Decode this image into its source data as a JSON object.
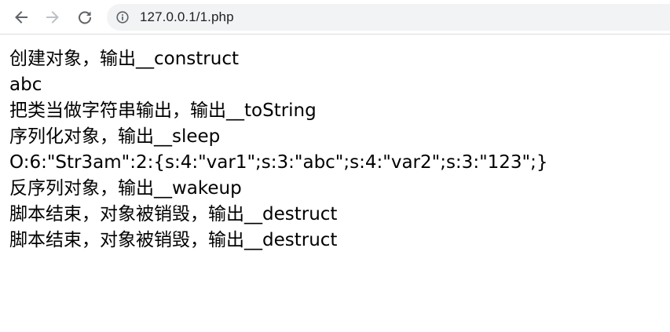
{
  "browser": {
    "url": "127.0.0.1/1.php"
  },
  "output_lines": [
    "创建对象，输出__construct",
    "abc",
    "把类当做字符串输出，输出__toString",
    "序列化对象，输出__sleep",
    "O:6:\"Str3am\":2:{s:4:\"var1\";s:3:\"abc\";s:4:\"var2\";s:3:\"123\";}",
    "反序列对象，输出__wakeup",
    "脚本结束，对象被销毁，输出__destruct",
    "脚本结束，对象被销毁，输出__destruct"
  ],
  "icons": {
    "back": "back-arrow-icon",
    "forward": "forward-arrow-icon",
    "reload": "reload-icon",
    "site_info": "info-icon"
  },
  "colors": {
    "toolbar_bg": "#ffffff",
    "omnibox_bg": "#f1f3f4",
    "icon_active": "#5f6368",
    "icon_disabled": "#bdc1c6",
    "text": "#000000"
  }
}
